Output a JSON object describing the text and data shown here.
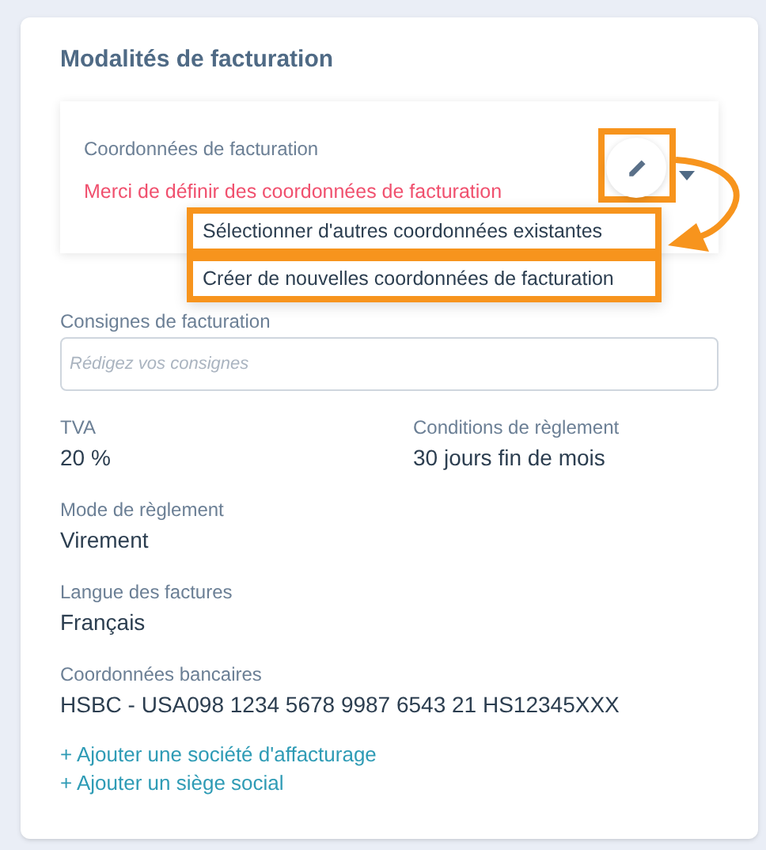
{
  "title": "Modalités de facturation",
  "billing_card": {
    "label": "Coordonnées de facturation",
    "message": "Merci de définir des coordonnées de facturation"
  },
  "menu": {
    "items": [
      {
        "label": "Sélectionner d'autres coordonnées existantes",
        "highlighted": true
      },
      {
        "label": "Créer de nouvelles coordonnées de facturation",
        "highlighted": true
      }
    ]
  },
  "instructions": {
    "label": "Consignes de facturation",
    "placeholder": "Rédigez vos consignes"
  },
  "fields": [
    {
      "label": "TVA",
      "value": "20 %"
    },
    {
      "label": "Conditions de règlement",
      "value": "30 jours fin de mois"
    },
    {
      "label": "Mode de règlement",
      "value": "Virement"
    },
    {
      "label": "Langue des factures",
      "value": "Français"
    },
    {
      "label": "Coordonnées bancaires",
      "value": "HSBC - USA098 1234 5678 9987 6543 21 HS12345XXX"
    }
  ],
  "links": [
    "+ Ajouter une société d'affacturage",
    "+ Ajouter un siège social"
  ]
}
